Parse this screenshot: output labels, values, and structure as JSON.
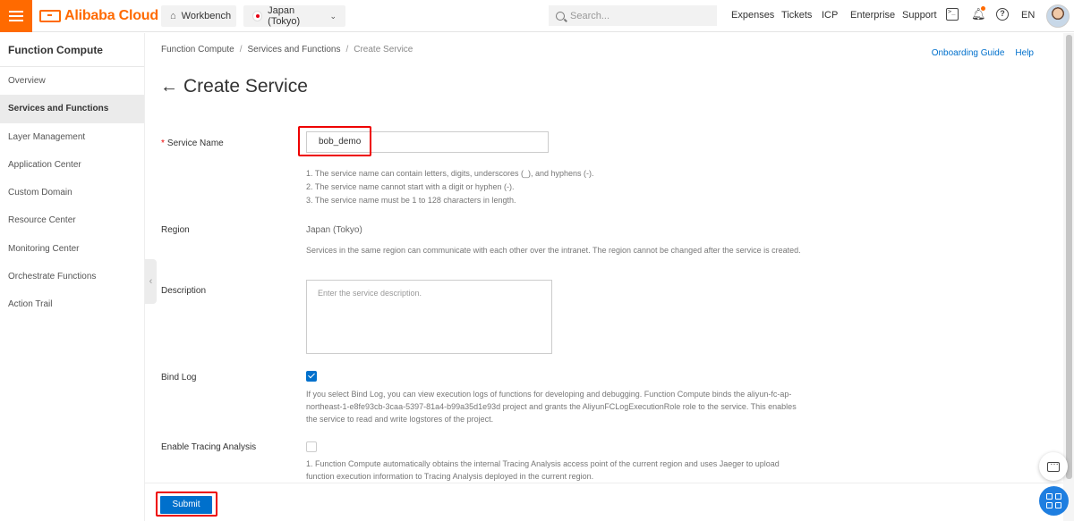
{
  "header": {
    "brand": "Alibaba Cloud",
    "workbench_label": "Workbench",
    "region_label": "Japan (Tokyo)",
    "search_placeholder": "Search...",
    "nav": [
      "Expenses",
      "Tickets",
      "ICP",
      "Enterprise",
      "Support"
    ],
    "language": "EN"
  },
  "sidebar": {
    "title": "Function Compute",
    "items": [
      {
        "label": "Overview",
        "active": false
      },
      {
        "label": "Services and Functions",
        "active": true
      },
      {
        "label": "Layer Management",
        "active": false
      },
      {
        "label": "Application Center",
        "active": false
      },
      {
        "label": "Custom Domain",
        "active": false
      },
      {
        "label": "Resource Center",
        "active": false
      },
      {
        "label": "Monitoring Center",
        "active": false
      },
      {
        "label": "Orchestrate Functions",
        "active": false
      },
      {
        "label": "Action Trail",
        "active": false
      }
    ]
  },
  "breadcrumb": [
    "Function Compute",
    "Services and Functions",
    "Create Service"
  ],
  "top_links": {
    "onboarding": "Onboarding Guide",
    "help": "Help"
  },
  "page_title": "Create Service",
  "form": {
    "service_name": {
      "label": "Service Name",
      "value": "bob_demo",
      "hints": [
        "1. The service name can contain letters, digits, underscores (_), and hyphens (-).",
        "2. The service name cannot start with a digit or hyphen (-).",
        "3. The service name must be 1 to 128 characters in length."
      ]
    },
    "region": {
      "label": "Region",
      "value": "Japan (Tokyo)",
      "hint": "Services in the same region can communicate with each other over the intranet. The region cannot be changed after the service is created."
    },
    "description": {
      "label": "Description",
      "placeholder": "Enter the service description."
    },
    "bind_log": {
      "label": "Bind Log",
      "checked": true,
      "hint": "If you select Bind Log, you can view execution logs of functions for developing and debugging. Function Compute binds the aliyun-fc-ap-northeast-1-e8fe93cb-3caa-5397-81a4-b99a35d1e93d project and grants the AliyunFCLogExecutionRole role to the service. This enables the service to read and write logstores of the project."
    },
    "tracing": {
      "label": "Enable Tracing Analysis",
      "checked": false,
      "hint": "1. Function Compute automatically obtains the internal Tracing Analysis access point of the current region and uses Jaeger to upload function execution information to Tracing Analysis deployed in the current region."
    }
  },
  "footer": {
    "submit_label": "Submit"
  },
  "colors": {
    "brand": "#ff6a00",
    "primary": "#0070cc",
    "highlight": "#e00000"
  }
}
